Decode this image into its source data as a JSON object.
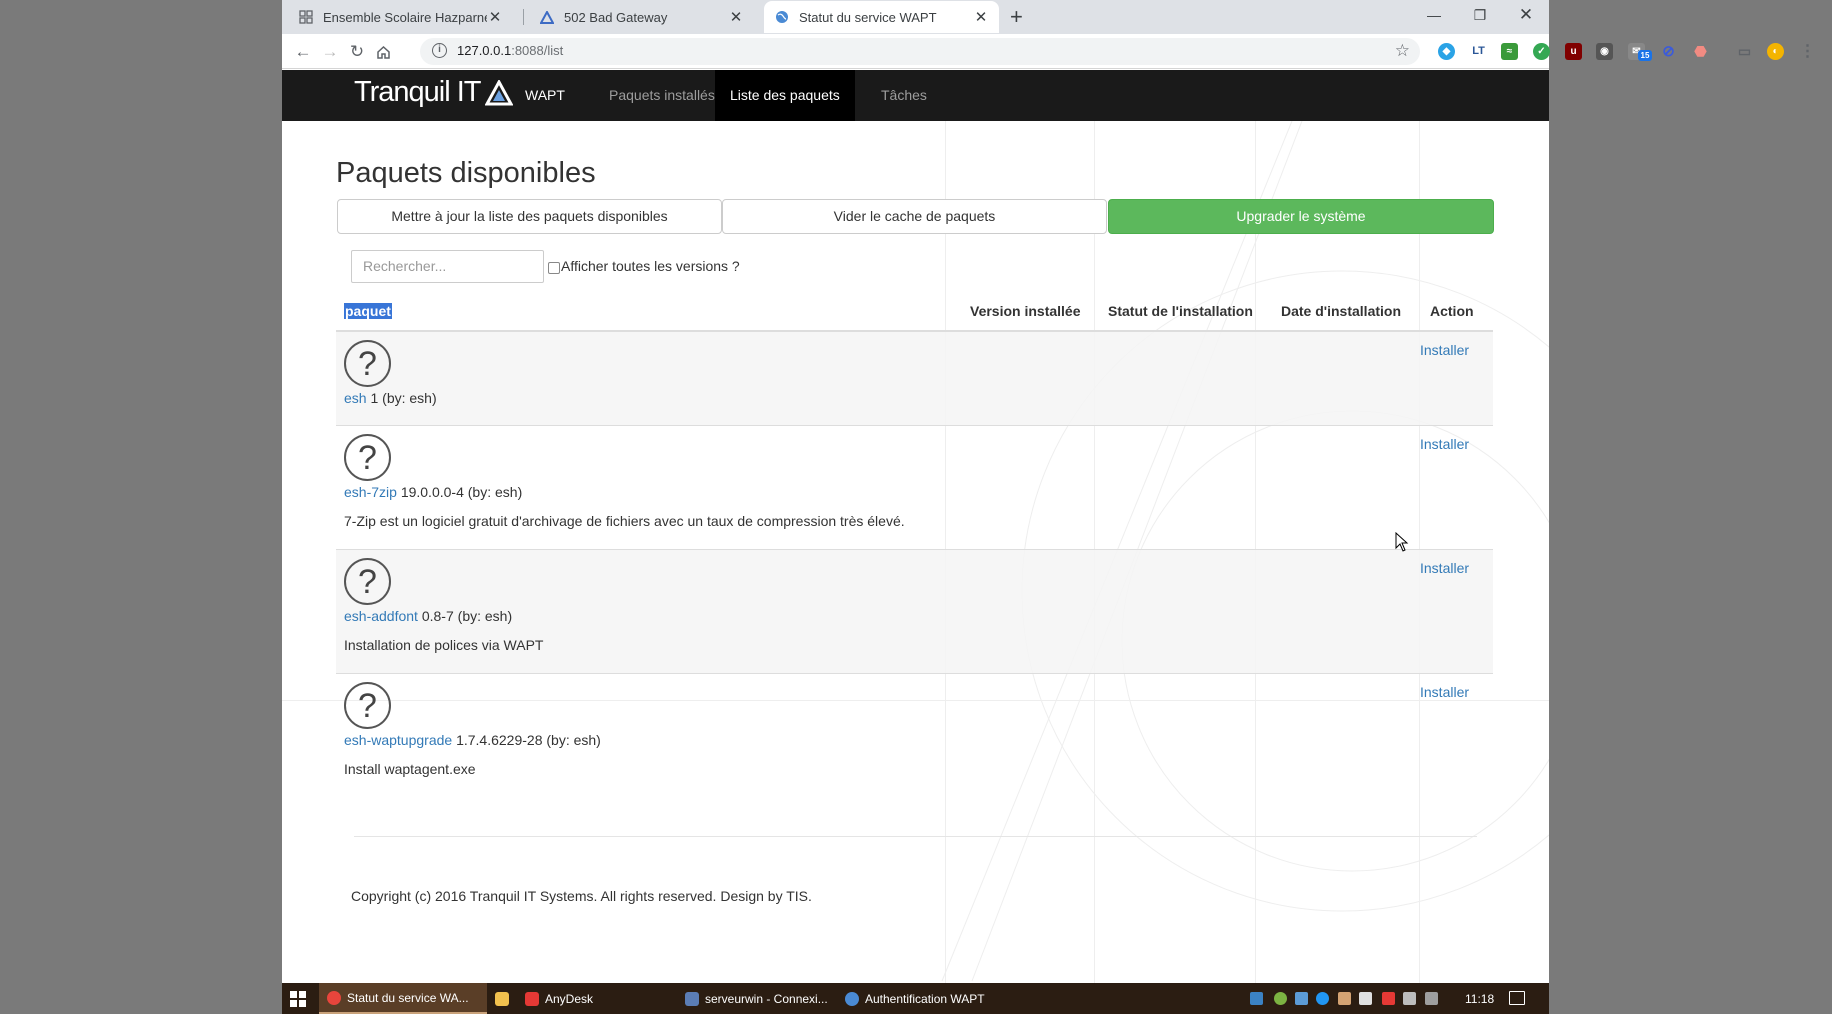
{
  "browser": {
    "tabs": [
      {
        "title": "Ensemble Scolaire Hazparne : de",
        "icon": "grid-icon"
      },
      {
        "title": "502 Bad Gateway",
        "icon": "tranquil-triangle-icon"
      },
      {
        "title": "Statut du service WAPT",
        "icon": "globe-icon"
      }
    ],
    "url_host": "127.0.0.1",
    "url_path": ":8088/list",
    "ext_badge": "15"
  },
  "nav": {
    "brand": "Tranquil IT",
    "items": [
      "WAPT",
      "Paquets installés",
      "Liste des paquets",
      "Tâches"
    ]
  },
  "page": {
    "title": "Paquets disponibles",
    "buttons": {
      "update": "Mettre à jour la liste des paquets disponibles",
      "clear_cache": "Vider le cache de paquets",
      "upgrade": "Upgrader le système"
    },
    "search_placeholder": "Rechercher...",
    "show_all_versions": "Afficher toutes les versions ?",
    "columns": {
      "package": "paquet",
      "installed_version": "Version installée",
      "install_status": "Statut de l'installation",
      "install_date": "Date d'installation",
      "action": "Action"
    },
    "packages": [
      {
        "name": "esh",
        "version": "1",
        "by": "(by: esh)",
        "description": "",
        "action": "Installer"
      },
      {
        "name": "esh-7zip",
        "version": "19.0.0.0-4",
        "by": "(by: esh)",
        "description": "7-Zip est un logiciel gratuit d'archivage de fichiers avec un taux de compression très élevé.",
        "action": "Installer"
      },
      {
        "name": "esh-addfont",
        "version": "0.8-7",
        "by": "(by: esh)",
        "description": "Installation de polices via WAPT",
        "action": "Installer"
      },
      {
        "name": "esh-waptupgrade",
        "version": "1.7.4.6229-28",
        "by": "(by: esh)",
        "description": "Install waptagent.exe",
        "action": "Installer"
      }
    ],
    "footer": "Copyright (c) 2016 Tranquil IT Systems. All rights reserved. Design by TIS."
  },
  "taskbar": {
    "items": [
      "Statut du service WA...",
      "AnyDesk",
      "serveurwin - Connexi...",
      "Authentification WAPT"
    ],
    "clock": "11:18"
  },
  "colors": {
    "navbar": "#1a1a1a",
    "success": "#5cb85c",
    "link": "#337ab7",
    "taskbar": "#2b1d12"
  }
}
